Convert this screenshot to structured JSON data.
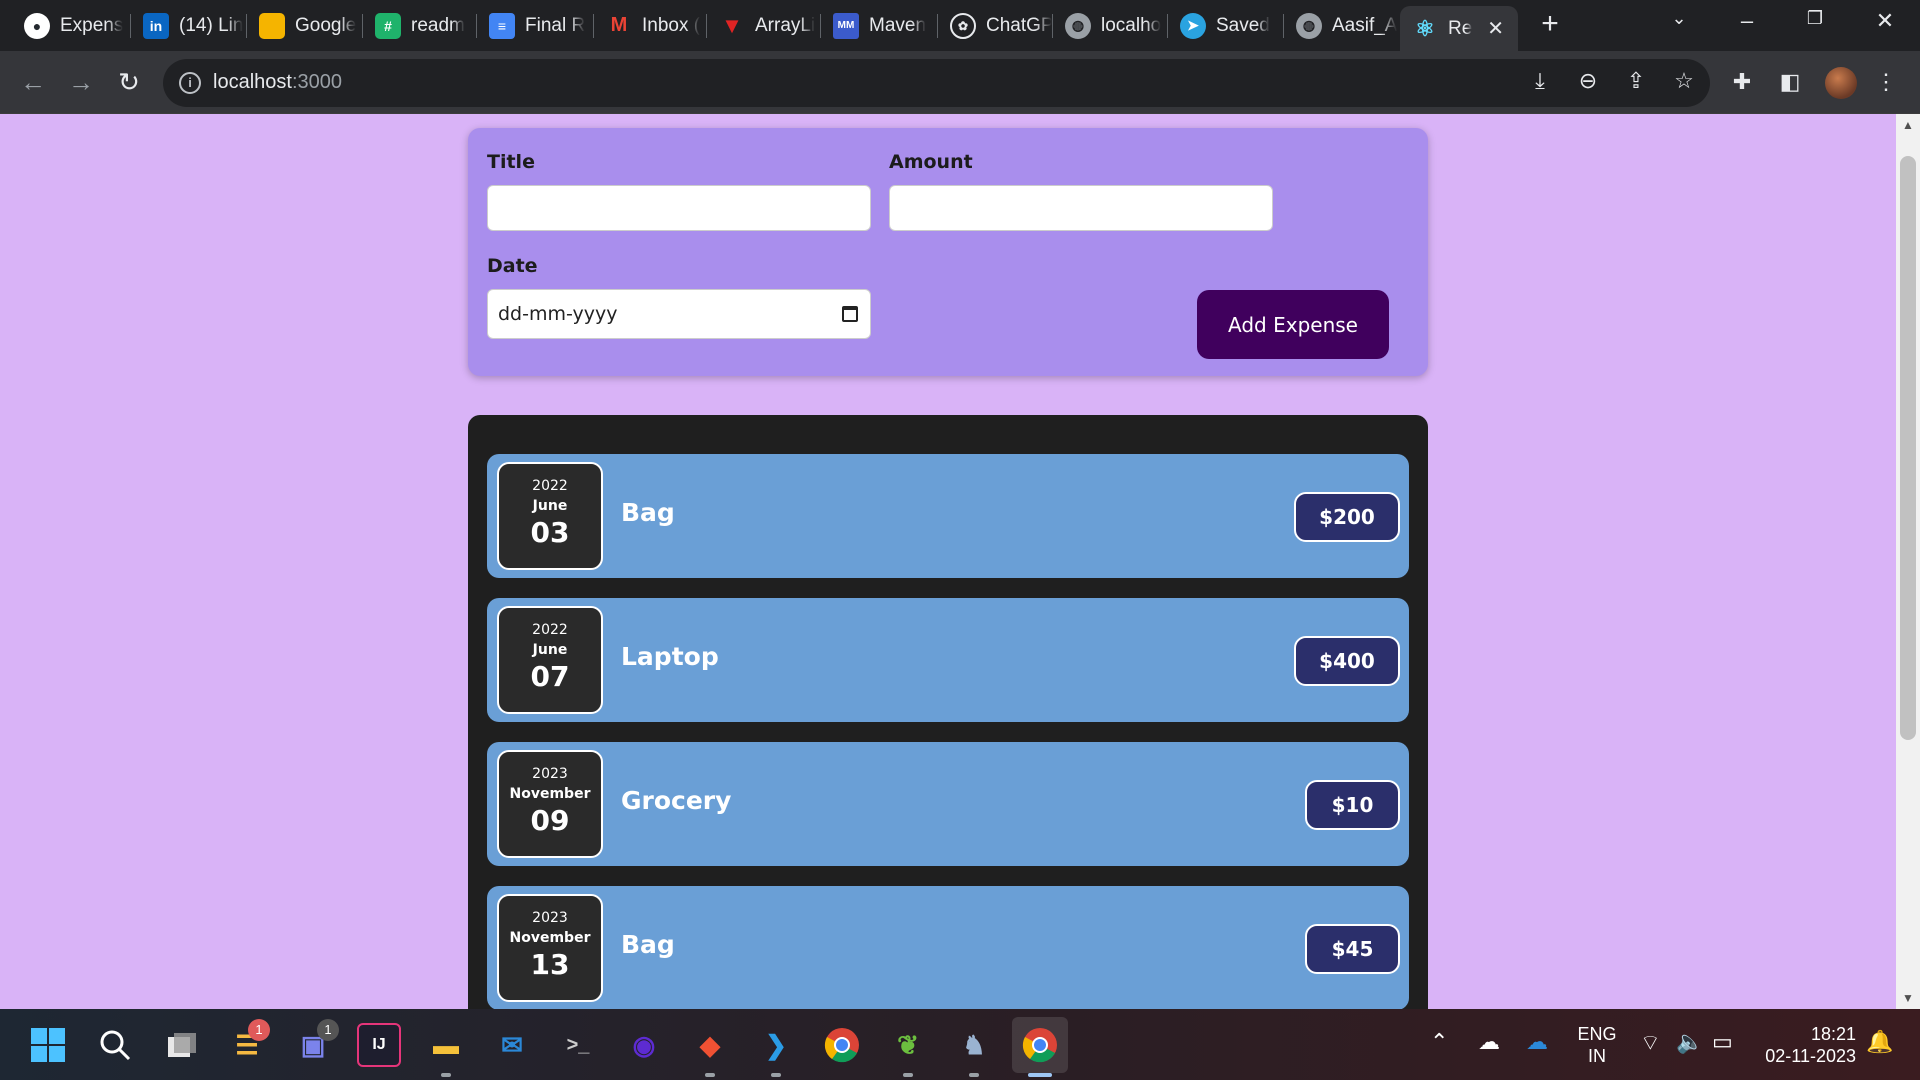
{
  "browser": {
    "tabs": [
      {
        "label": "Expens",
        "icon": "github-icon",
        "color": "#24292f"
      },
      {
        "label": "(14) Lin",
        "icon": "linkedin-icon",
        "color": "#0a66c2"
      },
      {
        "label": "Google",
        "icon": "google-keep-icon",
        "color": "#f5b400"
      },
      {
        "label": "readm",
        "icon": "readme-icon",
        "color": "#1fb36b"
      },
      {
        "label": "Final R",
        "icon": "docs-icon",
        "color": "#4285f4"
      },
      {
        "label": "Inbox (",
        "icon": "gmail-icon",
        "color": "#202124"
      },
      {
        "label": "ArrayLi",
        "icon": "arraylist-icon",
        "color": "#e02424"
      },
      {
        "label": "Maven",
        "icon": "maven-icon",
        "color": "#3b5bcc"
      },
      {
        "label": "ChatGP",
        "icon": "chatgpt-icon",
        "color": "#555"
      },
      {
        "label": "localho",
        "icon": "globe-icon",
        "color": "#5f6368"
      },
      {
        "label": "Saved",
        "icon": "telegram-icon",
        "color": "#2aa3e0"
      },
      {
        "label": "Aasif_A",
        "icon": "globe-icon",
        "color": "#5f6368"
      },
      {
        "label": "Re",
        "icon": "react-icon",
        "color": "#35363a"
      }
    ],
    "new_tab_symbol": "+",
    "url_host": "localhost",
    "url_port": ":3000"
  },
  "form": {
    "title_label": "Title",
    "amount_label": "Amount",
    "date_label": "Date",
    "title_value": "",
    "amount_value": "",
    "date_placeholder": "dd-mm-yyyy",
    "submit_label": "Add Expense"
  },
  "expenses": [
    {
      "year": "2022",
      "month": "June",
      "day": "03",
      "title": "Bag",
      "amount": "$200"
    },
    {
      "year": "2022",
      "month": "June",
      "day": "07",
      "title": "Laptop",
      "amount": "$400"
    },
    {
      "year": "2023",
      "month": "November",
      "day": "09",
      "title": "Grocery",
      "amount": "$10"
    },
    {
      "year": "2023",
      "month": "November",
      "day": "13",
      "title": "Bag",
      "amount": "$45"
    }
  ],
  "taskbar": {
    "badges": {
      "notes": "1",
      "teams": "1"
    },
    "language": "ENG",
    "region": "IN",
    "time": "18:21",
    "date": "02-11-2023"
  },
  "colors": {
    "page_bg": "#d9b3f7",
    "form_bg": "#a98eed",
    "list_bg": "#1f1f1f",
    "item_bg": "#6a9fd6",
    "button_bg": "#40005d",
    "price_bg": "#2b2f6b"
  }
}
